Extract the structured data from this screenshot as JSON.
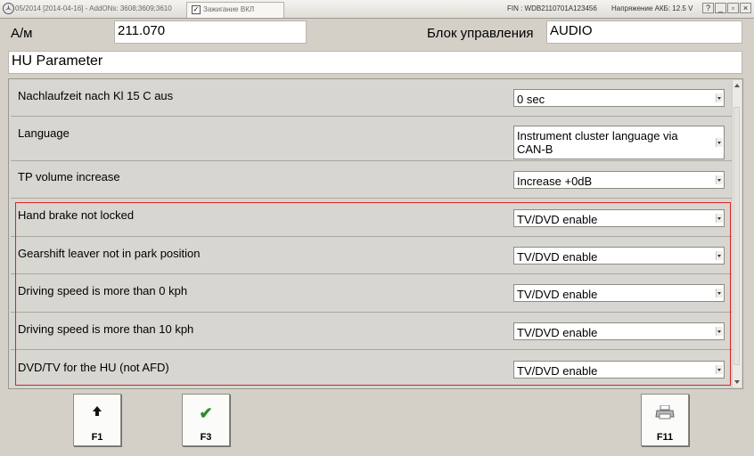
{
  "titlebar": {
    "version": "05/2014 [2014-04-16] - AddONs: 3608;3609;3610",
    "ignition_label": "Зажигание ВКЛ",
    "fin": "FIN : WDB2110701A123456",
    "battery_voltage": "Напряжение АКБ: 12.5 V",
    "help_button": "?",
    "minimize_button": "_",
    "restore_button": "▫",
    "close_button": "×"
  },
  "header": {
    "am_label": "А/м",
    "am_value": "211.070",
    "control_unit_label": "Блок управления",
    "control_unit_value": "AUDIO",
    "section_title": "HU Parameter"
  },
  "parameters": [
    {
      "label": "Nachlaufzeit nach Kl 15 C aus",
      "value": "0 sec"
    },
    {
      "label": "Language",
      "value": "Instrument cluster language via CAN-B"
    },
    {
      "label": "TP volume increase",
      "value": "Increase +0dB"
    },
    {
      "label": "Hand brake not locked",
      "value": "TV/DVD enable"
    },
    {
      "label": "Gearshift leaver not in park position",
      "value": "TV/DVD enable"
    },
    {
      "label": "Driving speed is more than 0 kph",
      "value": "TV/DVD enable"
    },
    {
      "label": "Driving speed is more than 10 kph",
      "value": "TV/DVD enable"
    },
    {
      "label": "DVD/TV for the HU (not AFD)",
      "value": "TV/DVD enable"
    }
  ],
  "highlight_color": "#e02020",
  "function_keys": [
    {
      "key": "F1",
      "icon": "up-arrow-icon",
      "glyph": "🡅"
    },
    {
      "key": "F3",
      "icon": "checkmark-icon",
      "glyph": "✔",
      "color": "#2e8b2e"
    },
    {
      "key": "F11",
      "icon": "printer-icon"
    }
  ]
}
